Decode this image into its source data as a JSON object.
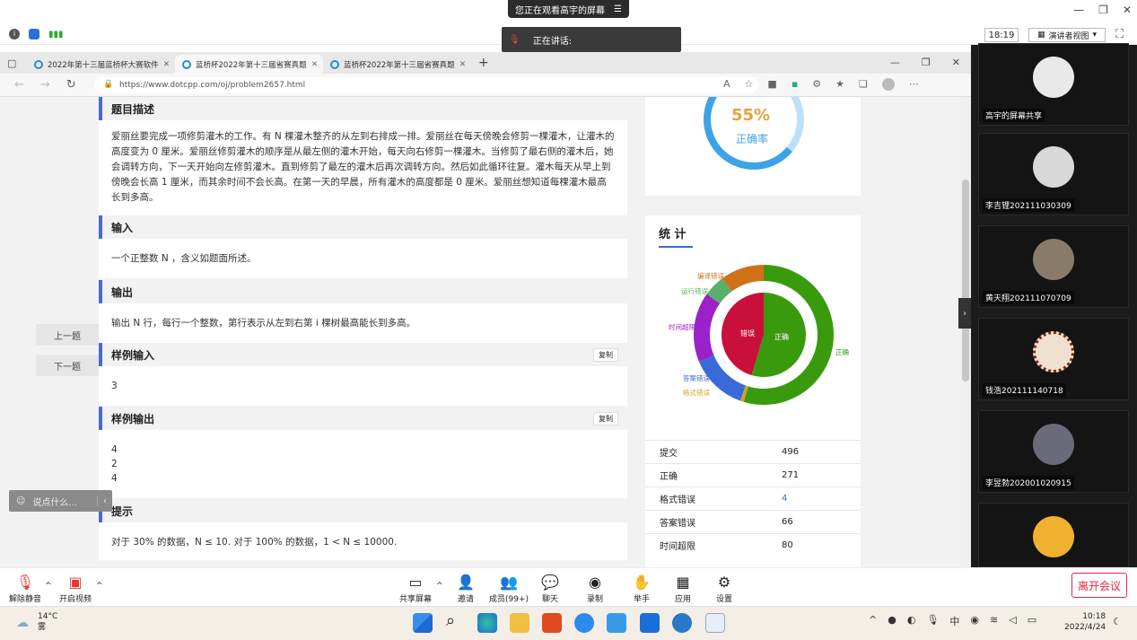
{
  "meeting": {
    "share_banner": "您正在观看高宇的屏幕",
    "speaking_label": "正在讲话:",
    "time": "18:19",
    "presenter_view": "演讲者视图"
  },
  "browser": {
    "tabs": [
      {
        "label": "2022年第十三届蓝桥杯大赛软件"
      },
      {
        "label": "蓝桥杯2022年第十三届省赛真题"
      },
      {
        "label": "蓝桥杯2022年第十三届省赛真题"
      }
    ],
    "url": "https://www.dotcpp.com/oj/problem2657.html"
  },
  "problem": {
    "desc_title": "题目描述",
    "desc_body": "爱丽丝要完成一项修剪灌木的工作。有 N 棵灌木整齐的从左到右排成一排。爱丽丝在每天傍晚会修剪一棵灌木，让灌木的高度变为 0 厘米。爱丽丝修剪灌木的顺序是从最左侧的灌木开始，每天向右修剪一棵灌木。当修剪了最右侧的灌木后，她会调转方向，下一天开始向左修剪灌木。直到修剪了最左的灌木后再次调转方向。然后如此循环往复。灌木每天从早上到傍晚会长高 1 厘米，而其余时间不会长高。在第一天的早晨，所有灌木的高度都是 0 厘米。爱丽丝想知道每棵灌木最高长到多高。",
    "input_title": "输入",
    "input_body": "一个正整数 N ，含义如题面所述。",
    "output_title": "输出",
    "output_body": "输出 N 行，每行一个整数，第行表示从左到右第 i 棵树最高能长到多高。",
    "sample_in_title": "样例输入",
    "sample_in": "3",
    "sample_out_title": "样例输出",
    "sample_out": [
      "4",
      "2",
      "4"
    ],
    "hint_title": "提示",
    "hint_body": "对于 30% 的数据，N ≤ 10. 对于 100% 的数据，1 < N ≤ 10000.",
    "copy_label": "复制",
    "prev": "上一题",
    "next": "下一题",
    "comment_placeholder": "说点什么..."
  },
  "side": {
    "rate_value": "55%",
    "rate_label": "正确率",
    "stats_title": "统 计",
    "chart_labels": {
      "correct_inner": "正确",
      "wrong_inner": "错误"
    },
    "stats": [
      {
        "label": "提交",
        "value": "496"
      },
      {
        "label": "正确",
        "value": "271"
      },
      {
        "label": "格式错误",
        "value": "4"
      },
      {
        "label": "答案错误",
        "value": "66"
      },
      {
        "label": "时间超限",
        "value": "80"
      }
    ]
  },
  "chart_data": {
    "type": "pie",
    "categories": [
      "正确",
      "格式错误",
      "答案错误",
      "时间超限",
      "运行错误",
      "编译错误"
    ],
    "values": [
      271,
      4,
      66,
      80,
      25,
      50
    ],
    "inner": [
      {
        "name": "正确",
        "value": 271
      },
      {
        "name": "错误",
        "value": 225
      }
    ],
    "colors": [
      "#3a9a0e",
      "#d6a020",
      "#3a6ad8",
      "#9a22c8",
      "#5ab06a",
      "#d0711a"
    ]
  },
  "videos": [
    {
      "name": "高宇的屏幕共享"
    },
    {
      "name": "李吉锂202111030309"
    },
    {
      "name": "黄天翔202111070709"
    },
    {
      "name": "钱浩202111140718"
    },
    {
      "name": "李昱勃202001020915"
    }
  ],
  "meeting_bar": {
    "mute": "解除静音",
    "video": "开启视频",
    "share": "共享屏幕",
    "invite": "邀请",
    "members": "成员(99+)",
    "chat": "聊天",
    "record": "录制",
    "hand": "举手",
    "apps": "应用",
    "settings": "设置",
    "leave": "离开会议"
  },
  "taskbar": {
    "weather_temp": "14°C",
    "weather_desc": "雾",
    "clock_time": "10:18",
    "clock_date": "2022/4/24"
  }
}
